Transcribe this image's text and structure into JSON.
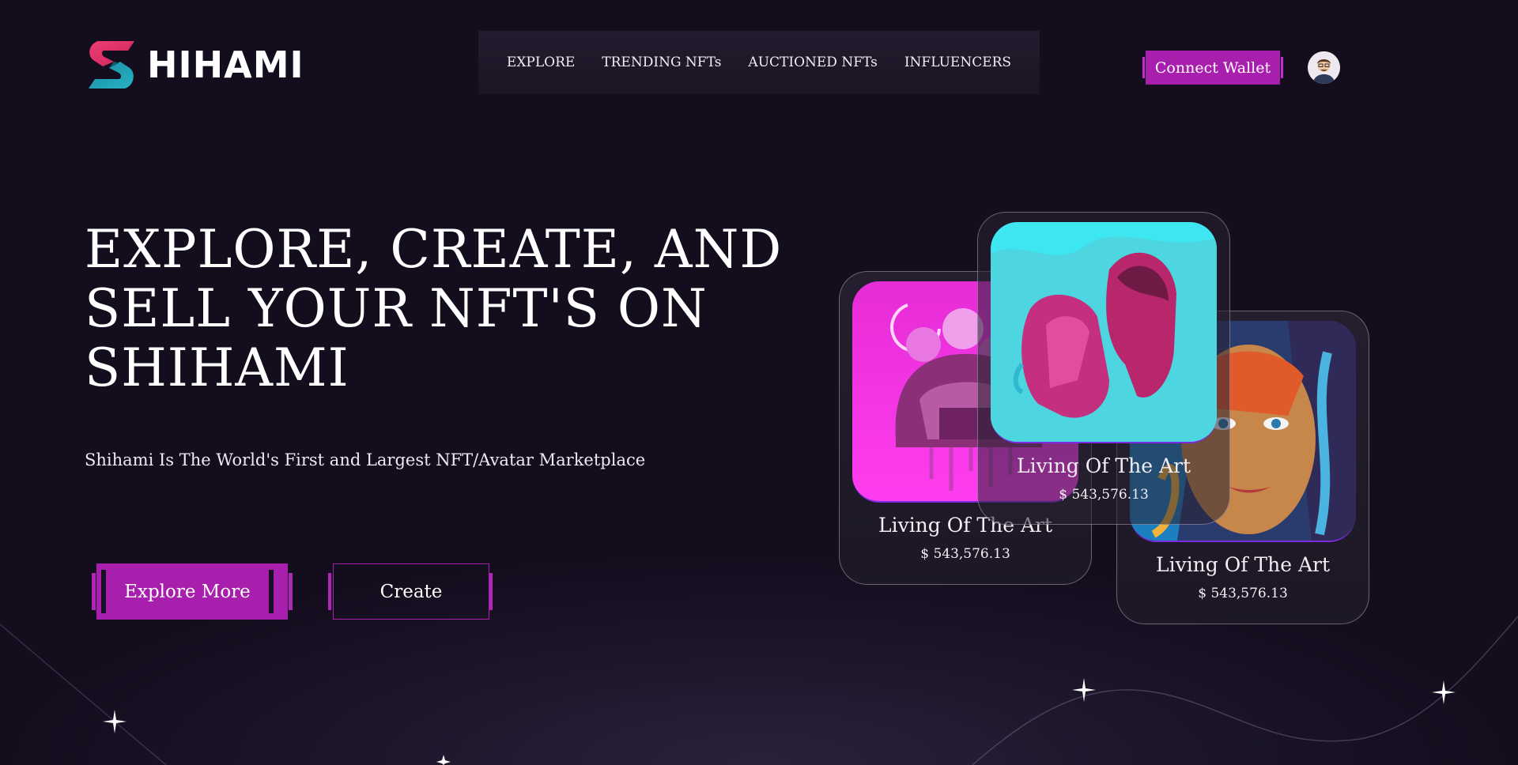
{
  "brand": {
    "name": "HIHAMI",
    "logo_letter": "S"
  },
  "nav": {
    "items": [
      "EXPLORE",
      "TRENDING NFTs",
      "AUCTIONED NFTs",
      "INFLUENCERS"
    ]
  },
  "header": {
    "connect_label": "Connect Wallet",
    "avatar": "user-avatar"
  },
  "hero": {
    "title": "EXPLORE, CREATE, AND SELL YOUR NFT'S ON SHIHAMI",
    "subtitle": "Shihami Is The World's First and Largest NFT/Avatar Marketplace",
    "explore_label": "Explore More",
    "create_label": "Create"
  },
  "cards": [
    {
      "title": "Living Of The Art",
      "price": "$ 543,576.13",
      "art": "pink-helmet-art"
    },
    {
      "title": "Living Of The Art",
      "price": "$ 543,576.13",
      "art": "cyan-statue-art"
    },
    {
      "title": "Living Of The Art",
      "price": "$ 543,576.13",
      "art": "colorful-face-art"
    }
  ],
  "colors": {
    "accent": "#a81fae",
    "background": "#130d1e",
    "nav_bg": "#1f1a2a"
  }
}
